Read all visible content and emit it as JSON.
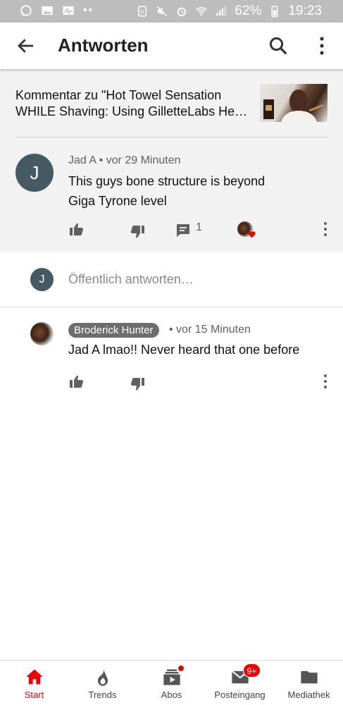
{
  "status_bar": {
    "battery": "62%",
    "time": "19:23"
  },
  "app_bar": {
    "title": "Antworten"
  },
  "context": {
    "line1": "Kommentar zu \"Hot Towel Sensation",
    "line2": "WHILE Shaving: Using GilletteLabs He…"
  },
  "comment": {
    "avatar_letter": "J",
    "author": "Jad A",
    "time": "vor 29 Minuten",
    "line1": "This guys bone structure is beyond",
    "line2": "Giga Tyrone level",
    "reply_count": "1"
  },
  "reply_input": {
    "avatar_letter": "J",
    "placeholder": "Öffentlich antworten…"
  },
  "reply": {
    "author": "Broderick Hunter",
    "time": "vor 15 Minuten",
    "text": "Jad A lmao!! Never heard that one before"
  },
  "bottom_nav": {
    "items": [
      {
        "label": "Start",
        "icon": "home-icon"
      },
      {
        "label": "Trends",
        "icon": "flame-icon"
      },
      {
        "label": "Abos",
        "icon": "subscriptions-icon"
      },
      {
        "label": "Posteingang",
        "icon": "mail-icon",
        "badge": "9+"
      },
      {
        "label": "Mediathek",
        "icon": "folder-icon"
      }
    ],
    "active_color": "#ee0000"
  },
  "colors": {
    "accent": "#ee0000",
    "avatar": "#465a64"
  }
}
